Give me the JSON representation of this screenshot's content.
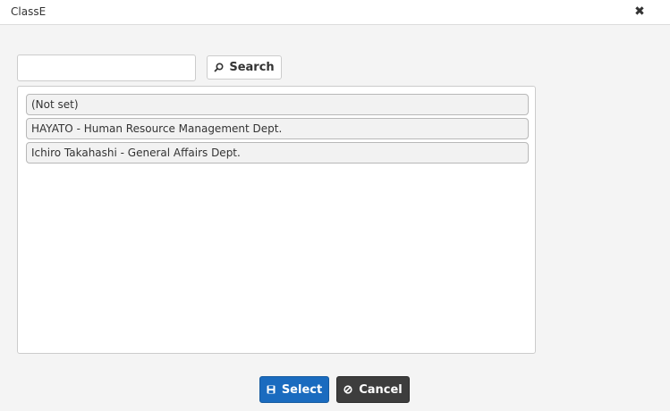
{
  "window": {
    "title": "ClassE"
  },
  "icons": {
    "close": "close-icon",
    "search": "search-icon",
    "select": "save-icon",
    "cancel": "cancel-icon"
  },
  "search": {
    "value": "",
    "placeholder": "",
    "button_label": "Search"
  },
  "list": {
    "items": [
      {
        "label": "(Not set)"
      },
      {
        "label": "HAYATO - Human Resource Management Dept."
      },
      {
        "label": "Ichiro Takahashi - General Affairs Dept."
      }
    ]
  },
  "footer": {
    "select_label": "Select",
    "cancel_label": "Cancel"
  },
  "colors": {
    "select": "#1a6bbf",
    "cancel": "#3d3d3d",
    "background": "#f4f4f4"
  }
}
